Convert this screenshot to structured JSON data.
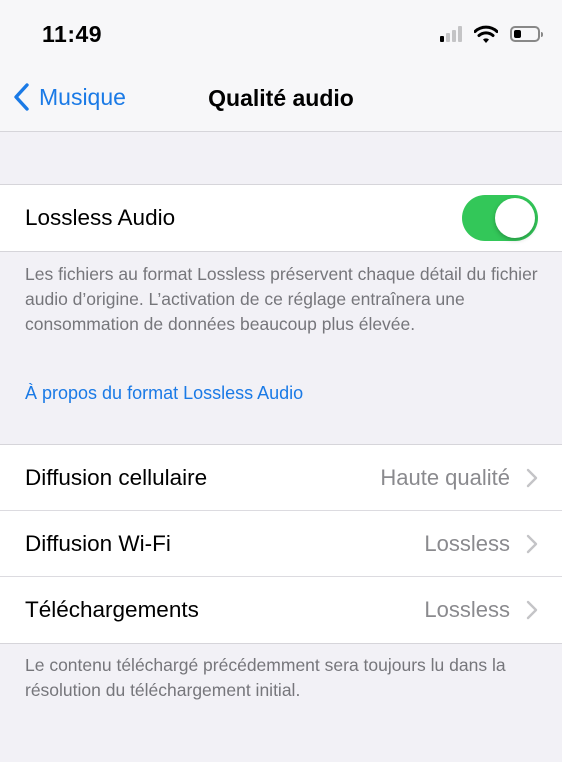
{
  "status_bar": {
    "time": "11:49",
    "signal_bars_active": 1,
    "battery_level": 0.3,
    "icons": [
      "cellular-signal-icon",
      "wifi-icon",
      "battery-icon"
    ]
  },
  "nav": {
    "back_label": "Musique",
    "title": "Qualité audio"
  },
  "lossless": {
    "label": "Lossless Audio",
    "enabled": true,
    "description": "Les fichiers au format Lossless préservent chaque détail du fichier audio d’origine. L’activation de ce réglage entraînera une consommation de données beaucoup plus élevée.",
    "link": "À propos du format Lossless Audio"
  },
  "settings": [
    {
      "label": "Diffusion cellulaire",
      "value": "Haute qualité"
    },
    {
      "label": "Diffusion Wi-Fi",
      "value": "Lossless"
    },
    {
      "label": "Téléchargements",
      "value": "Lossless"
    }
  ],
  "footer_note": "Le contenu téléchargé précédemment sera toujours lu dans la résolution du téléchargement initial.",
  "colors": {
    "accent": "#1a7ae6",
    "toggle_on": "#33c759",
    "background": "#f2f1f6",
    "secondary_text": "#8a8a8e"
  }
}
